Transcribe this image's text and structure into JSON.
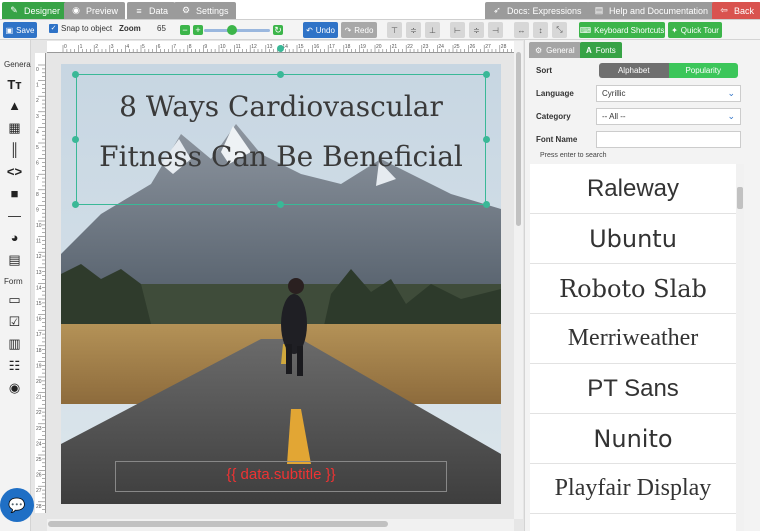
{
  "tabs": [
    {
      "label": "Designer",
      "icon": "pencil-icon"
    },
    {
      "label": "Preview",
      "icon": "eye-icon"
    },
    {
      "label": "Data",
      "icon": "database-icon"
    },
    {
      "label": "Settings",
      "icon": "gear-icon"
    },
    {
      "label": "Docs: Expressions",
      "icon": "rocket-icon"
    },
    {
      "label": "Help and Documentation",
      "icon": "book-icon"
    },
    {
      "label": "Back",
      "icon": "back-icon"
    }
  ],
  "toolbar": {
    "save_label": "Save",
    "snap_label": "Snap to object",
    "zoom_label": "Zoom",
    "zoom_value": "65",
    "zoom_level_fraction": 0.55,
    "undo_label": "Undo",
    "redo_label": "Redo",
    "shortcuts_label": "Keyboard Shortcuts",
    "tour_label": "Quick Tour"
  },
  "palette": {
    "general_label": "General",
    "form_label": "Form"
  },
  "canvas": {
    "title": "8 Ways Cardiovascular Fitness Can Be Beneficial",
    "subtitle_placeholder": "{{ data.subtitle }}",
    "ruler_numbers": [
      "0",
      "1",
      "2",
      "3",
      "4",
      "5",
      "6",
      "7",
      "8",
      "9",
      "10",
      "11",
      "12",
      "13",
      "14",
      "15",
      "16",
      "17",
      "18",
      "19",
      "20",
      "21",
      "22",
      "23",
      "24",
      "25",
      "26",
      "27",
      "28"
    ]
  },
  "panel": {
    "tab_general": "General",
    "tab_fonts": "Fonts",
    "sort_label": "Sort",
    "sort_options": [
      "Alphabet",
      "Popularity"
    ],
    "language_label": "Language",
    "language_value": "Cyrillic",
    "category_label": "Category",
    "category_value": "-- All --",
    "font_name_label": "Font Name",
    "font_name_hint": "Press enter to search",
    "fonts": [
      "Raleway",
      "Ubuntu",
      "Roboto Slab",
      "Merriweather",
      "PT Sans",
      "Nunito",
      "Playfair Display"
    ]
  },
  "colors": {
    "accent_green": "#37a346",
    "accent_blue": "#2f73c7",
    "danger_red": "#d9534f",
    "selection_teal": "#3ab897"
  }
}
